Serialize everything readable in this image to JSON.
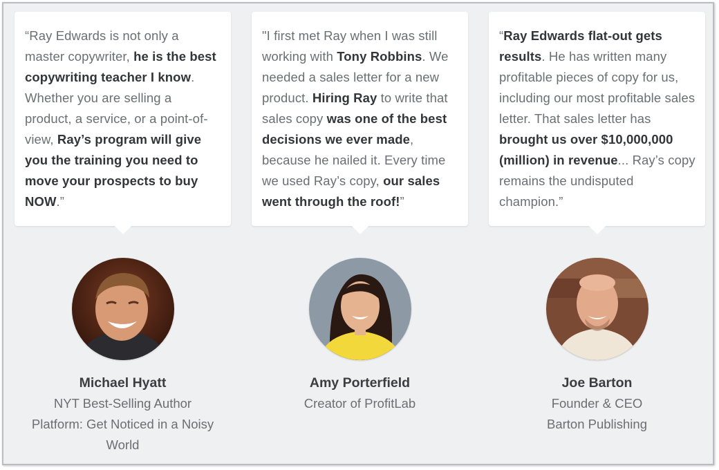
{
  "testimonials": [
    {
      "quote_parts": [
        {
          "text": "“Ray Edwards is not only a master copywriter, ",
          "bold": false
        },
        {
          "text": "he is the best copywriting teacher I know",
          "bold": true
        },
        {
          "text": ". Whether you are selling a product, a service, or a point-of-view, ",
          "bold": false
        },
        {
          "text": "Ray’s program will give you the training you need to move your prospects to buy NOW",
          "bold": true
        },
        {
          "text": ".”",
          "bold": false
        }
      ],
      "name": "Michael Hyatt",
      "role_lines": [
        "NYT Best-Selling Author",
        "Platform: Get Noticed in a Noisy World"
      ],
      "avatar": "michael-hyatt-photo"
    },
    {
      "quote_parts": [
        {
          "text": "\"I first met Ray when I was still working with ",
          "bold": false
        },
        {
          "text": "Tony Robbins",
          "bold": true
        },
        {
          "text": ". We needed a sales letter for a new product. ",
          "bold": false
        },
        {
          "text": "Hiring Ray",
          "bold": true
        },
        {
          "text": " to write that sales copy ",
          "bold": false
        },
        {
          "text": "was one of the best decisions we ever made",
          "bold": true
        },
        {
          "text": ", because he nailed it. Every time we used Ray’s copy, ",
          "bold": false
        },
        {
          "text": "our sales went through the roof!",
          "bold": true
        },
        {
          "text": "”",
          "bold": false
        }
      ],
      "name": "Amy Porterfield",
      "role_lines": [
        "Creator of ProfitLab"
      ],
      "avatar": "amy-porterfield-photo"
    },
    {
      "quote_parts": [
        {
          "text": "“",
          "bold": false
        },
        {
          "text": "Ray Edwards flat-out gets results",
          "bold": true
        },
        {
          "text": ". He has written many profitable pieces of copy for us, including our most profitable sales letter. That sales letter has ",
          "bold": false
        },
        {
          "text": "brought us over $10,000,000 (million) in revenue",
          "bold": true
        },
        {
          "text": "... Ray’s copy remains the undisputed champion.”",
          "bold": false
        }
      ],
      "name": "Joe Barton",
      "role_lines": [
        "Founder & CEO",
        "Barton Publishing"
      ],
      "avatar": "joe-barton-photo"
    }
  ]
}
